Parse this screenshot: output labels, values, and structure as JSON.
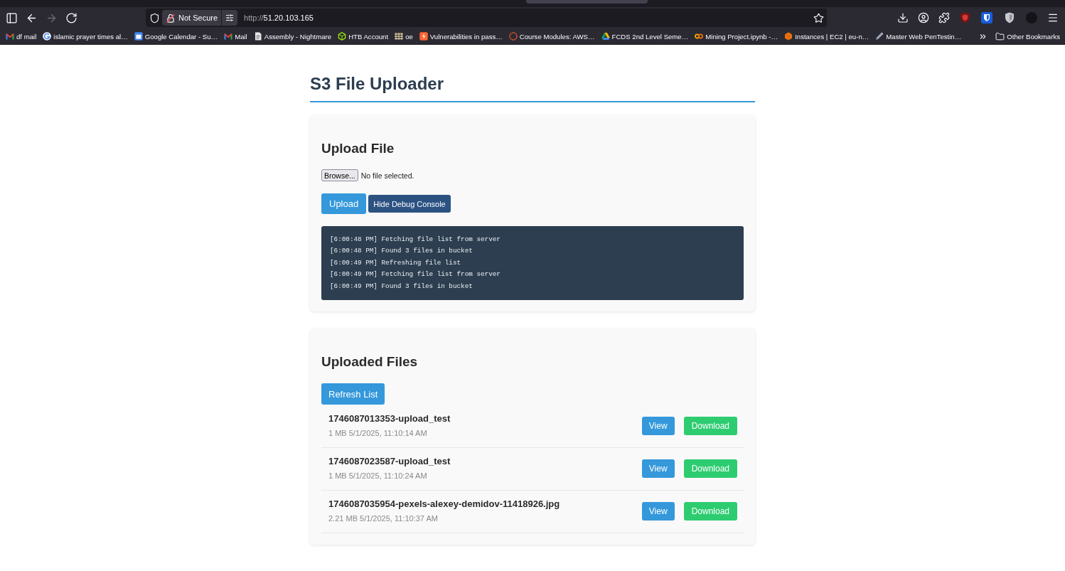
{
  "browser": {
    "nav_buttons": [
      {
        "kind": "sidebar",
        "disabled": false
      },
      {
        "kind": "back",
        "disabled": false
      },
      {
        "kind": "forward",
        "disabled": true
      },
      {
        "kind": "reload",
        "disabled": false
      }
    ],
    "security_label": "Not Secure",
    "url": {
      "scheme": "http://",
      "host": "51.20.103.165"
    },
    "bookmarks": [
      "df mail",
      "islamic prayer times al…",
      "Google Calendar - Su…",
      "Mail",
      "Assembly - Nightmare",
      "HTB Account",
      "oe",
      "Vulnerabilities in pass…",
      "Course Modules: AWS…",
      "FCDS 2nd Level Seme…",
      "Mining Project.ipynb -…",
      "Instances | EC2 | eu-n…",
      "Master Web PenTestin…"
    ],
    "other_bookmarks": "Other Bookmarks"
  },
  "page": {
    "title": "S3 File Uploader",
    "upload_card": {
      "heading": "Upload File",
      "browse_label": "Browse...",
      "file_status": "No file selected.",
      "buttons": [
        {
          "kind": "primary",
          "label": "Upload"
        },
        {
          "kind": "secondary",
          "label": "Hide Debug Console"
        }
      ],
      "log": [
        "[6:00:48 PM] Fetching file list from server",
        "[6:00:48 PM] Found 3 files in bucket",
        "[6:00:49 PM] Refreshing file list",
        "[6:00:49 PM] Fetching file list from server",
        "[6:00:49 PM] Found 3 files in bucket"
      ]
    },
    "files_card": {
      "heading": "Uploaded Files",
      "refresh_label": "Refresh List",
      "files": [
        {
          "name": "1746087013353-upload_test",
          "meta": "1 MB 5/1/2025, 11:10:14 AM",
          "actions": [
            {
              "kind": "view",
              "label": "View"
            },
            {
              "kind": "download",
              "label": "Download"
            }
          ]
        },
        {
          "name": "1746087023587-upload_test",
          "meta": "1 MB 5/1/2025, 11:10:24 AM",
          "actions": [
            {
              "kind": "view",
              "label": "View"
            },
            {
              "kind": "download",
              "label": "Download"
            }
          ]
        },
        {
          "name": "1746087035954-pexels-alexey-demidov-11418926.jpg",
          "meta": "2.21 MB 5/1/2025, 11:10:37 AM",
          "actions": [
            {
              "kind": "view",
              "label": "View"
            },
            {
              "kind": "download",
              "label": "Download"
            }
          ]
        }
      ]
    }
  }
}
